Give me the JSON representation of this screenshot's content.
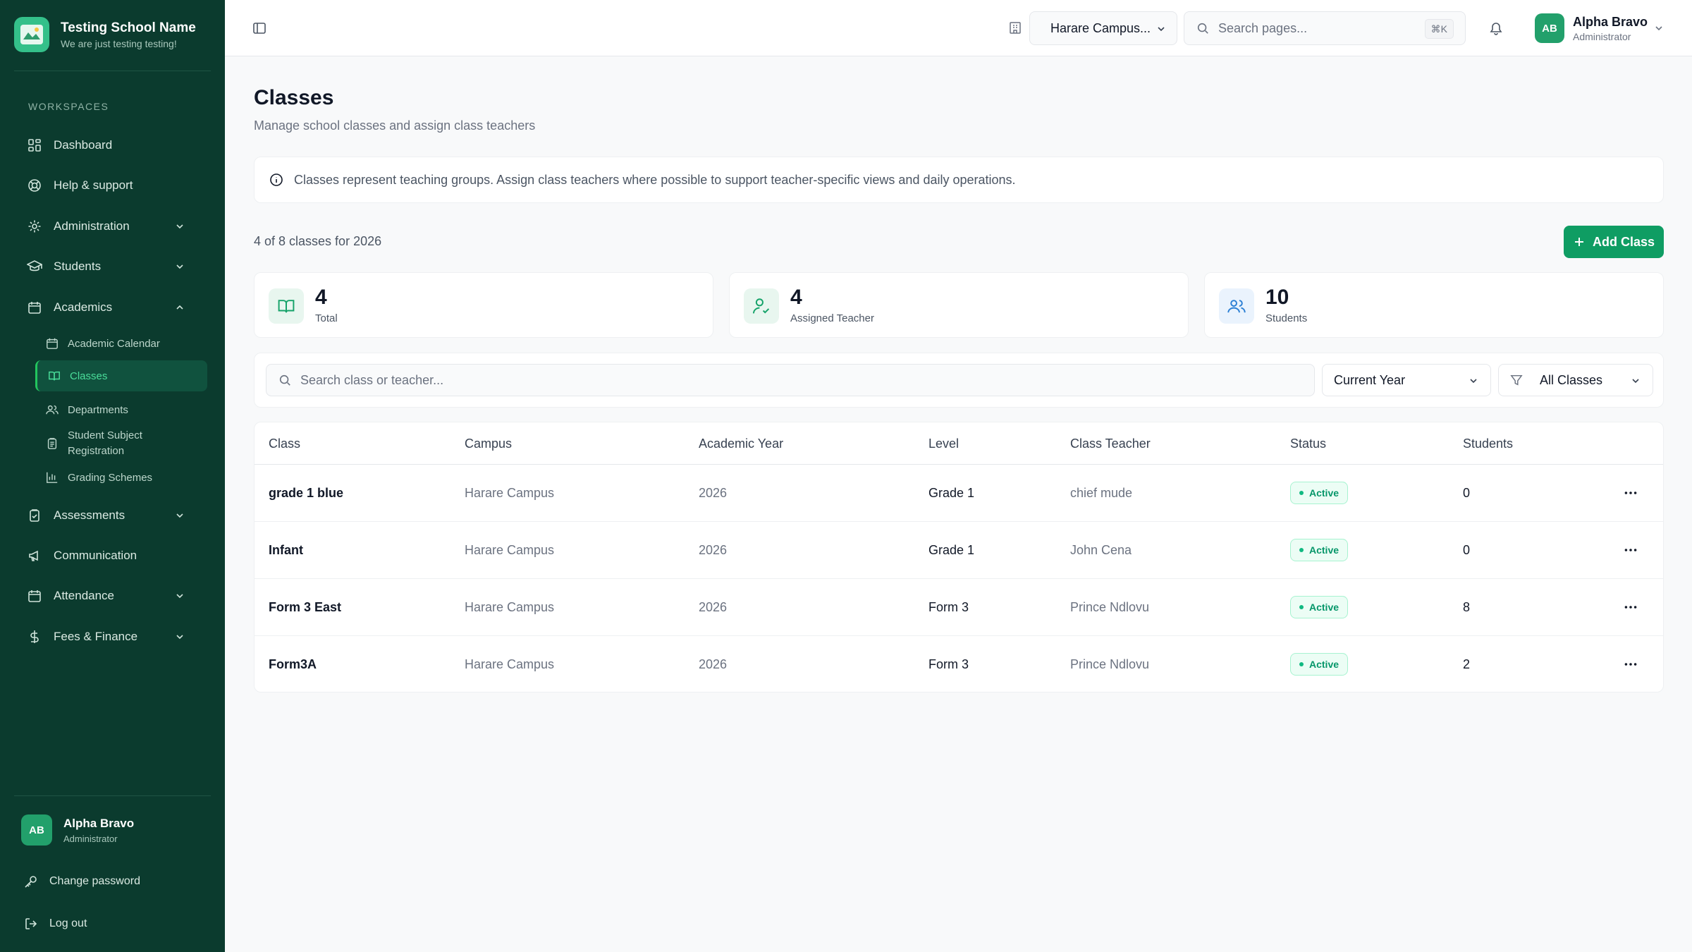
{
  "brand": {
    "name": "Testing School Name",
    "tagline": "We are just testing testing!"
  },
  "sidebar": {
    "section_label": "WORKSPACES",
    "items": [
      {
        "label": "Dashboard",
        "icon": "dashboard-icon"
      },
      {
        "label": "Help & support",
        "icon": "help-icon"
      },
      {
        "label": "Administration",
        "icon": "gear-icon"
      },
      {
        "label": "Students",
        "icon": "graduation-cap-icon"
      },
      {
        "label": "Academics",
        "icon": "calendar-icon"
      },
      {
        "label": "Assessments",
        "icon": "clipboard-check-icon"
      },
      {
        "label": "Communication",
        "icon": "megaphone-icon"
      },
      {
        "label": "Attendance",
        "icon": "calendar-icon"
      },
      {
        "label": "Fees & Finance",
        "icon": "dollar-icon"
      }
    ],
    "academics_sub": [
      {
        "label": "Academic Calendar"
      },
      {
        "label": "Classes",
        "active": true
      },
      {
        "label": "Departments"
      },
      {
        "label": "Student Subject Registration"
      },
      {
        "label": "Grading Schemes"
      }
    ],
    "user": {
      "initials": "AB",
      "name": "Alpha Bravo",
      "role": "Administrator"
    },
    "change_password": "Change password",
    "logout": "Log out"
  },
  "topbar": {
    "campus": "Harare Campus...",
    "search_placeholder": "Search pages...",
    "shortcut": "⌘K",
    "user": {
      "initials": "AB",
      "name": "Alpha Bravo",
      "role": "Administrator"
    }
  },
  "page": {
    "title": "Classes",
    "subtitle": "Manage school classes and assign class teachers",
    "info": "Classes represent teaching groups. Assign class teachers where possible to support teacher-specific views and daily operations.",
    "count_text": "4 of 8 classes for 2026",
    "add_button": "Add Class"
  },
  "stats": [
    {
      "value": "4",
      "label": "Total"
    },
    {
      "value": "4",
      "label": "Assigned Teacher"
    },
    {
      "value": "10",
      "label": "Students"
    }
  ],
  "filters": {
    "search_placeholder": "Search class or teacher...",
    "year": "Current Year",
    "classes": "All Classes"
  },
  "table": {
    "headers": [
      "Class",
      "Campus",
      "Academic Year",
      "Level",
      "Class Teacher",
      "Status",
      "Students"
    ],
    "rows": [
      {
        "class": "grade 1 blue",
        "campus": "Harare Campus",
        "year": "2026",
        "level": "Grade 1",
        "teacher": "chief mude",
        "status": "Active",
        "students": "0"
      },
      {
        "class": "Infant",
        "campus": "Harare Campus",
        "year": "2026",
        "level": "Grade 1",
        "teacher": "John Cena",
        "status": "Active",
        "students": "0"
      },
      {
        "class": "Form 3 East",
        "campus": "Harare Campus",
        "year": "2026",
        "level": "Form 3",
        "teacher": "Prince Ndlovu",
        "status": "Active",
        "students": "8"
      },
      {
        "class": "Form3A",
        "campus": "Harare Campus",
        "year": "2026",
        "level": "Form 3",
        "teacher": "Prince Ndlovu",
        "status": "Active",
        "students": "2"
      }
    ]
  },
  "colors": {
    "sidebar": "#0b3b2e",
    "accent": "#0f9d63",
    "active_text": "#4ade9a"
  }
}
